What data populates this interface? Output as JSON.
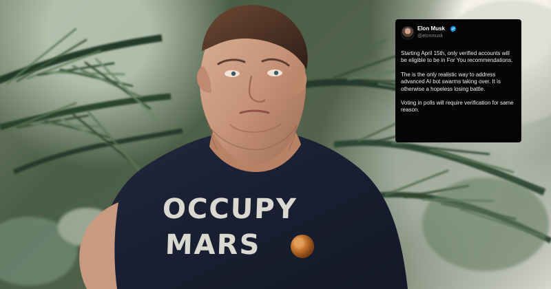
{
  "image": {
    "subject": "Elon Musk",
    "shirt": {
      "line_1": "OCCUPY",
      "line_2": "MARS",
      "icon": "mars-planet-icon"
    }
  },
  "tweet": {
    "author_name": "Elon Musk",
    "handle": "@elonmusk",
    "verified_icon": "verified-badge-icon",
    "paragraphs": [
      "Starting April 15th, only verified accounts will be eligible to be in For You recommendations.",
      "The is the only realistic way to address advanced AI bot swarms taking over. It is otherwise a hopeless losing battle.",
      "Voting in polls will require verification for same reason."
    ]
  },
  "colors": {
    "tweet_background": "#050505",
    "tweet_text": "#f0f0f0",
    "handle_text": "#8a8a8a",
    "verified_blue": "#1d9bf0",
    "shirt_text": "#d9d9d2",
    "mars_orange": "#c7772f"
  }
}
